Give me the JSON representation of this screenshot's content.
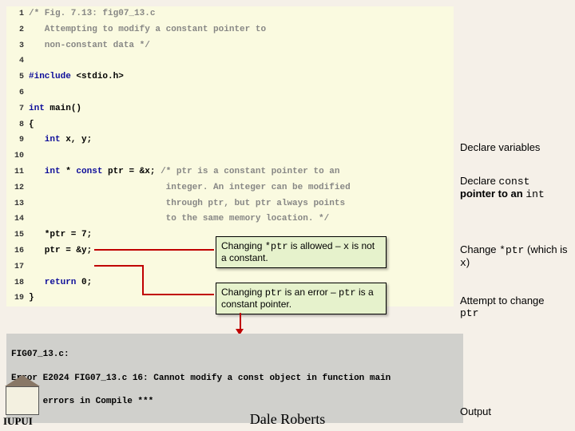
{
  "code": {
    "l1": "/* Fig. 7.13: fig07_13.c",
    "l2": "   Attempting to modify a constant pointer to",
    "l3": "   non-constant data */",
    "l4": " ",
    "l5a": "#include ",
    "l5b": "<stdio.h>",
    "l6": " ",
    "l7a": "int",
    "l7b": " main()",
    "l8": "{",
    "l9a": "   int",
    "l9b": " x, y;",
    "l10": " ",
    "l11a": "   int",
    "l11b": " * ",
    "l11c": "const",
    "l11d": " ptr = &x; ",
    "l11e": "/* ptr is a constant pointer to an",
    "l12": "                          integer. An integer can be modified",
    "l13": "                          through ptr, but ptr always points  ",
    "l14": "                          to the same memory location. */",
    "l15": "   *ptr = 7;",
    "l16": "   ptr = &y;",
    "l17": " ",
    "l18a": "   return",
    "l18b": " 0;",
    "l19": "}"
  },
  "lineno": {
    "n1": "1",
    "n2": "2",
    "n3": "3",
    "n4": "4",
    "n5": "5",
    "n6": "6",
    "n7": "7",
    "n8": "8",
    "n9": "9",
    "n10": "10",
    "n11": "11",
    "n12": "12",
    "n13": "13",
    "n14": "14",
    "n15": "15",
    "n16": "16",
    "n17": "17",
    "n18": "18",
    "n19": "19"
  },
  "anno": {
    "a1": "Declare variables",
    "a2a": "Declare ",
    "a2b": "const",
    "a2c": " pointer to an ",
    "a2d": "int",
    "a3a": "Change ",
    "a3b": "*ptr",
    "a3c": " (which is ",
    "a3d": "x",
    "a3e": ")",
    "a4a": "Attempt to change ",
    "a4b": "ptr",
    "a5": "Output"
  },
  "callout": {
    "c1a": "Changing ",
    "c1b": "*ptr",
    "c1c": " is allowed – ",
    "c1d": "x",
    "c1e": " is not a constant.",
    "c2a": "Changing ",
    "c2b": "ptr",
    "c2c": " is an error – ",
    "c2d": "ptr",
    "c2e": " is a constant pointer."
  },
  "output": {
    "l1": "FIG07_13.c:",
    "l2": "Error E2024 FIG07_13.c 16: Cannot modify a const object in function main",
    "l3": "*** 1 errors in Compile ***"
  },
  "footer": "Dale Roberts",
  "logo": "IUPUI"
}
